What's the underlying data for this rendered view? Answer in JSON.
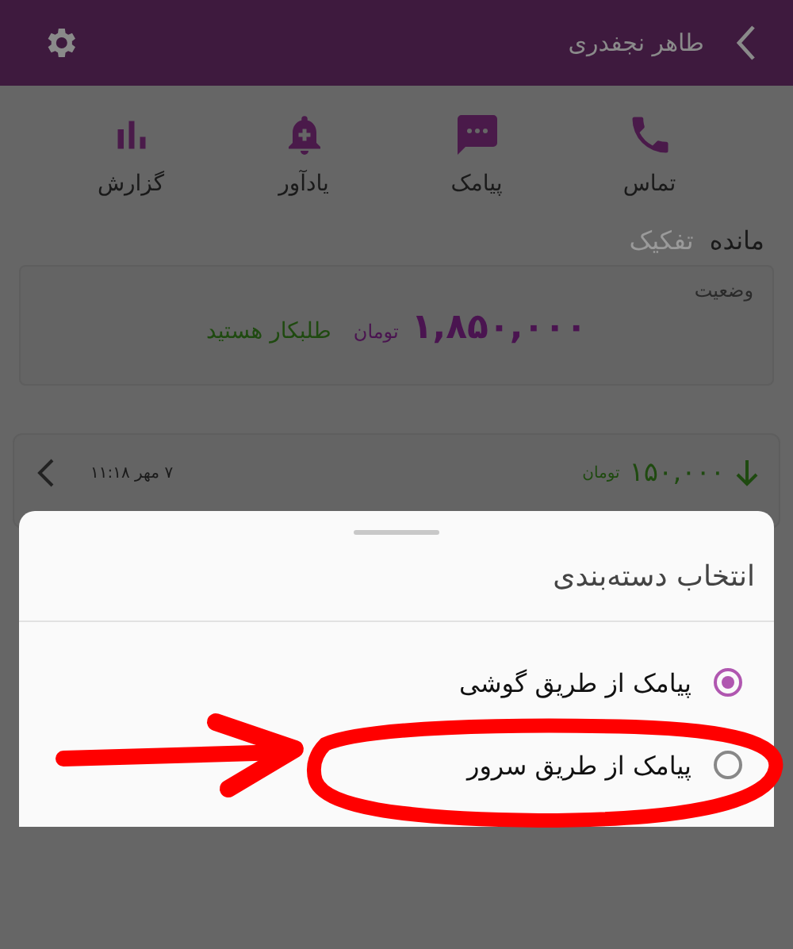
{
  "header": {
    "title": "طاهر نجفدری"
  },
  "actions": [
    {
      "label": "تماس",
      "kind": "call"
    },
    {
      "label": "پیامک",
      "kind": "sms"
    },
    {
      "label": "یادآور",
      "kind": "reminder"
    },
    {
      "label": "گزارش",
      "kind": "report"
    }
  ],
  "tabs": [
    {
      "label": "مانده",
      "selected": true
    },
    {
      "label": "تفکیک",
      "selected": false
    }
  ],
  "status_card": {
    "label": "وضعیت",
    "amount": "۱,۸۵۰,۰۰۰",
    "currency": "تومان",
    "status": "طلبکار هستید"
  },
  "transaction": {
    "amount": "۱۵۰,۰۰۰",
    "currency": "تومان",
    "date": "۷ مهر ۱۱:۱۸"
  },
  "sheet": {
    "title": "انتخاب دسته‌بندی",
    "options": [
      {
        "label": "پیامک از طریق گوشی",
        "selected": true
      },
      {
        "label": "پیامک از طریق سرور",
        "selected": false
      }
    ]
  }
}
